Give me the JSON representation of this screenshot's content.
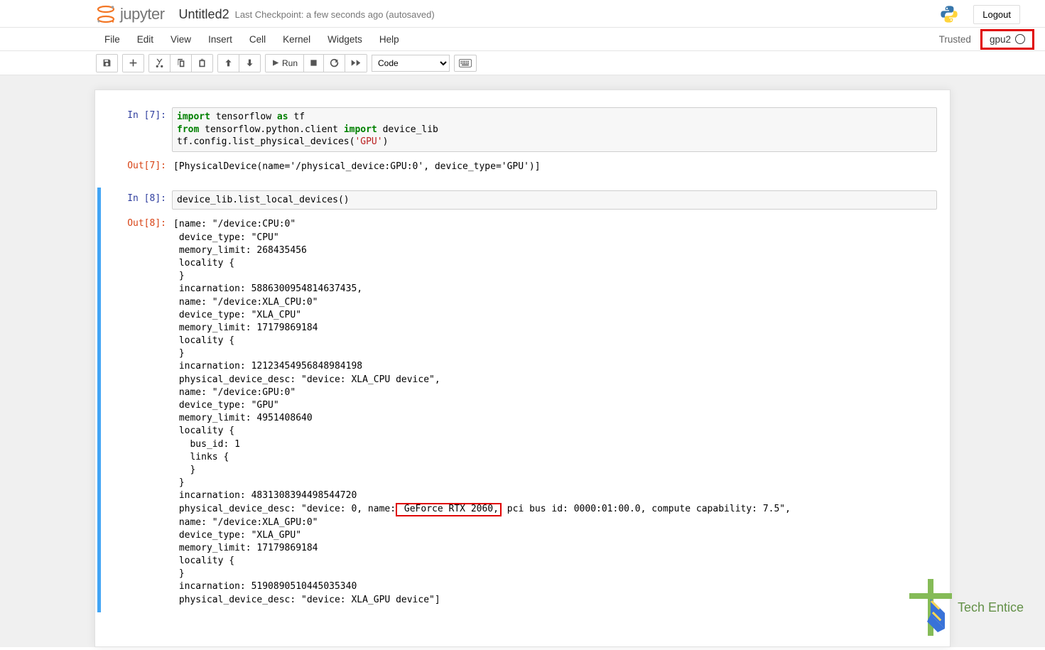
{
  "header": {
    "logo_text": "jupyter",
    "notebook_name": "Untitled2",
    "checkpoint_status": "Last Checkpoint: a few seconds ago  (autosaved)",
    "logout_label": "Logout"
  },
  "menubar": {
    "items": [
      "File",
      "Edit",
      "View",
      "Insert",
      "Cell",
      "Kernel",
      "Widgets",
      "Help"
    ],
    "trusted_label": "Trusted",
    "kernel_name": "gpu2"
  },
  "toolbar": {
    "run_label": "Run",
    "cell_type": "Code"
  },
  "cells": [
    {
      "in_prompt": "In [7]:",
      "code_tokens": [
        {
          "t": "kw",
          "v": "import"
        },
        {
          "t": "txt",
          "v": " tensorflow "
        },
        {
          "t": "kw",
          "v": "as"
        },
        {
          "t": "txt",
          "v": " tf\n"
        },
        {
          "t": "kw",
          "v": "from"
        },
        {
          "t": "txt",
          "v": " tensorflow.python.client "
        },
        {
          "t": "kw",
          "v": "import"
        },
        {
          "t": "txt",
          "v": " device_lib\n"
        },
        {
          "t": "txt",
          "v": "tf.config.list_physical_devices("
        },
        {
          "t": "str",
          "v": "'GPU'"
        },
        {
          "t": "txt",
          "v": ")"
        }
      ],
      "out_prompt": "Out[7]:",
      "output": "[PhysicalDevice(name='/physical_device:GPU:0', device_type='GPU')]"
    },
    {
      "in_prompt": "In [8]:",
      "code_tokens": [
        {
          "t": "txt",
          "v": "device_lib.list_local_devices()"
        }
      ],
      "out_prompt": "Out[8]:",
      "output_pre": "[name: \"/device:CPU:0\"\n device_type: \"CPU\"\n memory_limit: 268435456\n locality {\n }\n incarnation: 5886300954814637435,\n name: \"/device:XLA_CPU:0\"\n device_type: \"XLA_CPU\"\n memory_limit: 17179869184\n locality {\n }\n incarnation: 12123454956848984198\n physical_device_desc: \"device: XLA_CPU device\",\n name: \"/device:GPU:0\"\n device_type: \"GPU\"\n memory_limit: 4951408640\n locality {\n   bus_id: 1\n   links {\n   }\n }\n incarnation: 4831308394498544720\n physical_device_desc: \"device: 0, name:",
      "highlighted": " GeForce RTX 2060,",
      "output_post": " pci bus id: 0000:01:00.0, compute capability: 7.5\",\n name: \"/device:XLA_GPU:0\"\n device_type: \"XLA_GPU\"\n memory_limit: 17179869184\n locality {\n }\n incarnation: 5190890510445035340\n physical_device_desc: \"device: XLA_GPU device\"]"
    }
  ],
  "watermark": "Tech Entice"
}
